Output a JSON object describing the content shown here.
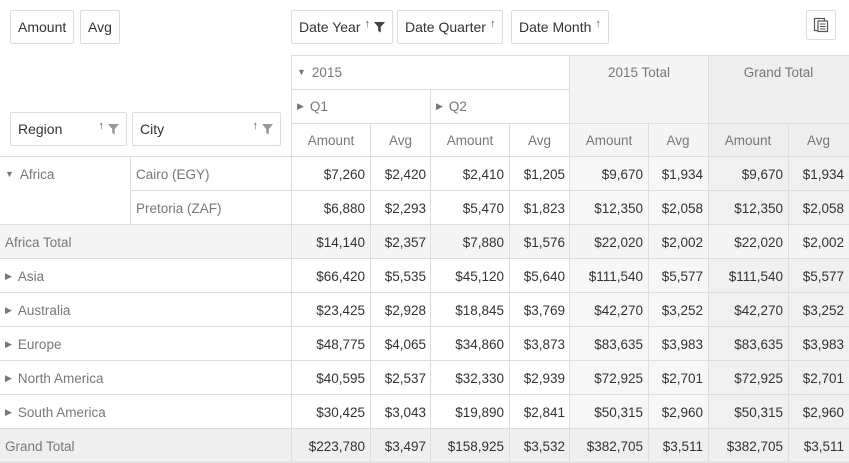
{
  "data_fields": [
    "Amount",
    "Avg"
  ],
  "column_fields": [
    {
      "label": "Date Year",
      "sort": "↑",
      "filtered": true
    },
    {
      "label": "Date Quarter",
      "sort": "↑",
      "filtered": false
    },
    {
      "label": "Date Month",
      "sort": "↑",
      "filtered": false
    }
  ],
  "row_fields": [
    {
      "label": "Region",
      "sort": "↑"
    },
    {
      "label": "City",
      "sort": "↑"
    }
  ],
  "column_headers": {
    "year": "2015",
    "quarters": [
      "Q1",
      "Q2"
    ],
    "year_total": "2015 Total",
    "grand_total": "Grand Total",
    "measures": [
      "Amount",
      "Avg",
      "Amount",
      "Avg",
      "Amount",
      "Avg",
      "Amount",
      "Avg"
    ]
  },
  "rows": [
    {
      "region": "Africa",
      "city": "Cairo (EGY)",
      "values": [
        "$7,260",
        "$2,420",
        "$2,410",
        "$1,205",
        "$9,670",
        "$1,934",
        "$9,670",
        "$1,934"
      ]
    },
    {
      "region": "",
      "city": "Pretoria (ZAF)",
      "values": [
        "$6,880",
        "$2,293",
        "$5,470",
        "$1,823",
        "$12,350",
        "$2,058",
        "$12,350",
        "$2,058"
      ]
    },
    {
      "region": "Africa Total",
      "city": "",
      "values": [
        "$14,140",
        "$2,357",
        "$7,880",
        "$1,576",
        "$22,020",
        "$2,002",
        "$22,020",
        "$2,002"
      ]
    },
    {
      "region": "Asia",
      "city": "",
      "values": [
        "$66,420",
        "$5,535",
        "$45,120",
        "$5,640",
        "$111,540",
        "$5,577",
        "$111,540",
        "$5,577"
      ]
    },
    {
      "region": "Australia",
      "city": "",
      "values": [
        "$23,425",
        "$2,928",
        "$18,845",
        "$3,769",
        "$42,270",
        "$3,252",
        "$42,270",
        "$3,252"
      ]
    },
    {
      "region": "Europe",
      "city": "",
      "values": [
        "$48,775",
        "$4,065",
        "$34,860",
        "$3,873",
        "$83,635",
        "$3,983",
        "$83,635",
        "$3,983"
      ]
    },
    {
      "region": "North America",
      "city": "",
      "values": [
        "$40,595",
        "$2,537",
        "$32,330",
        "$2,939",
        "$72,925",
        "$2,701",
        "$72,925",
        "$2,701"
      ]
    },
    {
      "region": "South America",
      "city": "",
      "values": [
        "$30,425",
        "$3,043",
        "$19,890",
        "$2,841",
        "$50,315",
        "$2,960",
        "$50,315",
        "$2,960"
      ]
    },
    {
      "region": "Grand Total",
      "city": "",
      "values": [
        "$223,780",
        "$3,497",
        "$158,925",
        "$3,532",
        "$382,705",
        "$3,511",
        "$382,705",
        "$3,511"
      ]
    }
  ],
  "colors": {
    "border": "#dddddd",
    "total_bg": "#f5f5f5",
    "grand_bg": "#eeeeee",
    "text": "#333333",
    "muted": "#777777"
  }
}
